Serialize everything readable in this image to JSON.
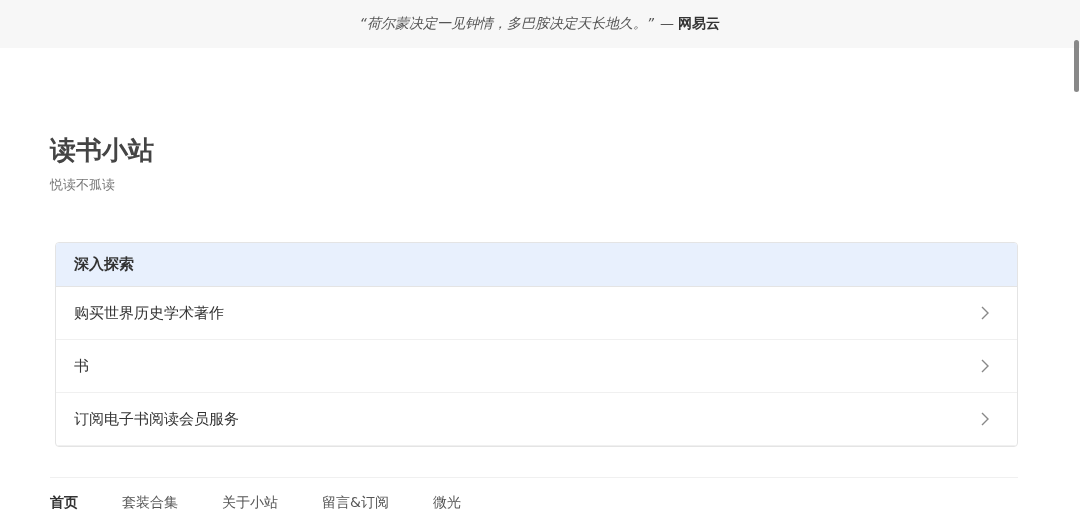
{
  "quote_bar": {
    "quote": "“荷尔蒙决定一见钟情，多巴胺决定天长地久。”",
    "attribution": "— **网易云**"
  },
  "site": {
    "title": "读书小站",
    "subtitle": "悦读不孤读"
  },
  "panel": {
    "title": "深入探索",
    "items": [
      {
        "label": "购买世界历史学术著作"
      },
      {
        "label": "书"
      },
      {
        "label": "订阅电子书阅读会员服务"
      }
    ]
  },
  "nav": [
    {
      "label": "首页",
      "selected": true
    },
    {
      "label": "套装合集",
      "selected": false
    },
    {
      "label": "关于小站",
      "selected": false
    },
    {
      "label": "留言&订阅",
      "selected": false
    },
    {
      "label": "微光",
      "selected": false
    }
  ]
}
